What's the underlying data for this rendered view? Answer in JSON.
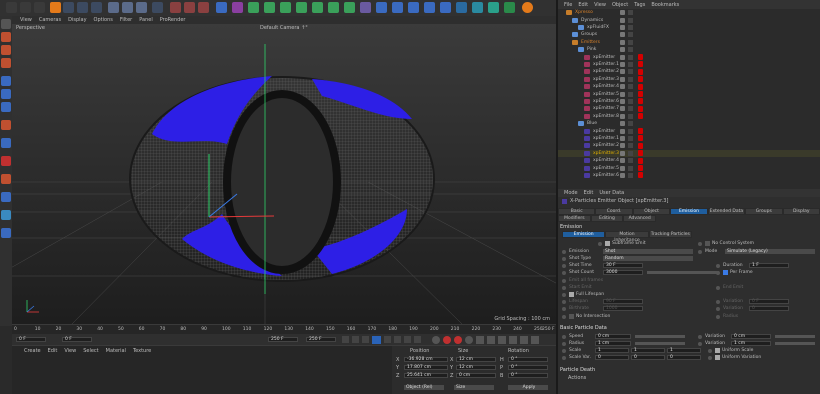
{
  "menu": {
    "view": "View",
    "cameras": "Cameras",
    "display": "Display",
    "options": "Options",
    "filter": "Filter",
    "panel": "Panel",
    "prorender": "ProRender"
  },
  "viewport": {
    "left_label": "Perspective",
    "camera_label": "Default Camera ↑°",
    "grid_spacing": "Grid Spacing : 100 cm"
  },
  "timeline": {
    "ticks": [
      "0",
      "5",
      "10",
      "15",
      "20",
      "25",
      "30",
      "35",
      "40",
      "45",
      "50",
      "55",
      "60",
      "65",
      "70",
      "75",
      "80",
      "85",
      "90",
      "95",
      "100",
      "105",
      "110",
      "115",
      "120",
      "125",
      "130",
      "135",
      "140",
      "145",
      "150",
      "155",
      "160",
      "165",
      "170",
      "175",
      "180",
      "185",
      "190",
      "195",
      "200",
      "205",
      "210",
      "215",
      "220",
      "225",
      "230",
      "235",
      "240",
      "245",
      "250"
    ],
    "end_frame": "250 F"
  },
  "timectrl": {
    "start": "0 F",
    "start2": "0 F",
    "end1": "250 F",
    "end2": "250 F"
  },
  "material_menu": {
    "create": "Create",
    "edit": "Edit",
    "view": "View",
    "select": "Select",
    "material": "Material",
    "texture": "Texture"
  },
  "coords": {
    "headers": {
      "position": "Position",
      "size": "Size",
      "rotation": "Rotation"
    },
    "rows": [
      {
        "axis": "X",
        "pos": "-36.928 cm",
        "size": "12 cm",
        "rot_axis": "H",
        "rot": "0 °"
      },
      {
        "axis": "Y",
        "pos": "17.807 cm",
        "size": "12 cm",
        "rot_axis": "P",
        "rot": "0 °"
      },
      {
        "axis": "Z",
        "pos": "25.641 cm",
        "size": "0 cm",
        "rot_axis": "B",
        "rot": "0 °"
      }
    ],
    "mode": "Object (Rel)",
    "size_mode": "Size",
    "apply": "Apply"
  },
  "object_menu": {
    "file": "File",
    "edit": "Edit",
    "view": "View",
    "object": "Object",
    "tags": "Tags",
    "bookmarks": "Bookmarks"
  },
  "objects": [
    {
      "name": "Xpresso",
      "level": 0,
      "color": "#c67d2a",
      "text_color": "#d9822b",
      "red": false
    },
    {
      "name": "Dynamics",
      "level": 1,
      "color": "#5c8fd6",
      "text_color": "#bdbdbd",
      "red": false
    },
    {
      "name": "xpFluidFX",
      "level": 2,
      "color": "#5c8fd6",
      "text_color": "#bdbdbd",
      "red": false
    },
    {
      "name": "Groups",
      "level": 1,
      "color": "#5c8fd6",
      "text_color": "#bdbdbd",
      "red": false
    },
    {
      "name": "Emitters",
      "level": 1,
      "color": "#c67d2a",
      "text_color": "#d9822b",
      "red": false
    },
    {
      "name": "Pink",
      "level": 2,
      "color": "#5c8fd6",
      "text_color": "#bdbdbd",
      "red": false
    },
    {
      "name": "xpEmitter",
      "level": 3,
      "color": "#a0335a",
      "text_color": "#bdbdbd",
      "red": true
    },
    {
      "name": "xpEmitter.1",
      "level": 3,
      "color": "#a0335a",
      "text_color": "#bdbdbd",
      "red": true
    },
    {
      "name": "xpEmitter.2",
      "level": 3,
      "color": "#a0335a",
      "text_color": "#bdbdbd",
      "red": true
    },
    {
      "name": "xpEmitter.3",
      "level": 3,
      "color": "#a0335a",
      "text_color": "#bdbdbd",
      "red": true
    },
    {
      "name": "xpEmitter.4",
      "level": 3,
      "color": "#a0335a",
      "text_color": "#bdbdbd",
      "red": true
    },
    {
      "name": "xpEmitter.5",
      "level": 3,
      "color": "#a0335a",
      "text_color": "#bdbdbd",
      "red": true
    },
    {
      "name": "xpEmitter.6",
      "level": 3,
      "color": "#a0335a",
      "text_color": "#bdbdbd",
      "red": true
    },
    {
      "name": "xpEmitter.7",
      "level": 3,
      "color": "#a0335a",
      "text_color": "#bdbdbd",
      "red": true
    },
    {
      "name": "xpEmitter.8",
      "level": 3,
      "color": "#a0335a",
      "text_color": "#bdbdbd",
      "red": true
    },
    {
      "name": "Blue",
      "level": 2,
      "color": "#5c8fd6",
      "text_color": "#bdbdbd",
      "red": false
    },
    {
      "name": "xpEmitter",
      "level": 3,
      "color": "#4a3aa0",
      "text_color": "#bdbdbd",
      "red": true
    },
    {
      "name": "xpEmitter.1",
      "level": 3,
      "color": "#4a3aa0",
      "text_color": "#bdbdbd",
      "red": true
    },
    {
      "name": "xpEmitter.2",
      "level": 3,
      "color": "#4a3aa0",
      "text_color": "#bdbdbd",
      "red": true
    },
    {
      "name": "xpEmitter.3",
      "level": 3,
      "color": "#4a3aa0",
      "text_color": "#e0b000",
      "red": true
    },
    {
      "name": "xpEmitter.4",
      "level": 3,
      "color": "#4a3aa0",
      "text_color": "#bdbdbd",
      "red": true
    },
    {
      "name": "xpEmitter.5",
      "level": 3,
      "color": "#4a3aa0",
      "text_color": "#bdbdbd",
      "red": true
    },
    {
      "name": "xpEmitter.6",
      "level": 3,
      "color": "#4a3aa0",
      "text_color": "#bdbdbd",
      "red": true
    }
  ],
  "attr_menu": {
    "mode": "Mode",
    "edit": "Edit",
    "user_data": "User Data"
  },
  "attr": {
    "title": "X-Particles Emitter Object [xpEmitter.3]",
    "tabs1": [
      "Basic",
      "Coord.",
      "Object",
      "Emission",
      "Extended Data",
      "Groups",
      "Display"
    ],
    "tabs2": [
      "Modifiers",
      "Editing",
      "Advanced"
    ],
    "section_emission": "Emission",
    "subtabs": [
      "Emission",
      "Motion Inheritance",
      "Tracking Particles"
    ],
    "subframe_emit": "Subframe Emit",
    "no_control_system": "No Control System",
    "emission": "Emission",
    "emission_val": "Shot",
    "mode": "Mode",
    "mode_val": "Simulate (Legacy)",
    "shot_type": "Shot Type",
    "shot_type_val": "Random",
    "shot_time": "Shot Time",
    "shot_time_val": "30 F",
    "duration": "Duration",
    "duration_val": "1 F",
    "shot_count": "Shot Count",
    "shot_count_val": "3000",
    "per_frame": "Per Frame",
    "emit_all_frames": "Emit all frames",
    "start_emit": "Start Emit",
    "end_emit": "End Emit",
    "full_lifespan": "Full Lifespan",
    "lifespan": "Lifespan",
    "lifespan_val": "90 F",
    "variation": "Variation",
    "variation_val": "0 F",
    "birthrate": "Birthrate",
    "birthrate_val": "1000",
    "variation2": "Variation",
    "variation2_val": "0",
    "no_intersection": "No Intersection",
    "radius": "Radius",
    "section_basic": "Basic Particle Data",
    "speed": "Speed",
    "speed_val": "0 cm",
    "speed_var": "Variation",
    "speed_var_val": "0 cm",
    "radius_val": "1 cm",
    "radius_var": "Variation",
    "radius_var_val": "1 cm",
    "scale": "Scale",
    "scale_vals": [
      "1",
      "1",
      "1"
    ],
    "uniform_scale": "Uniform Scale",
    "scale_var": "Scale Var.",
    "scale_var_vals": [
      "0",
      "0",
      "0"
    ],
    "uniform_variation": "Uniform Variation",
    "section_death": "Particle Death",
    "actions": "Actions"
  }
}
